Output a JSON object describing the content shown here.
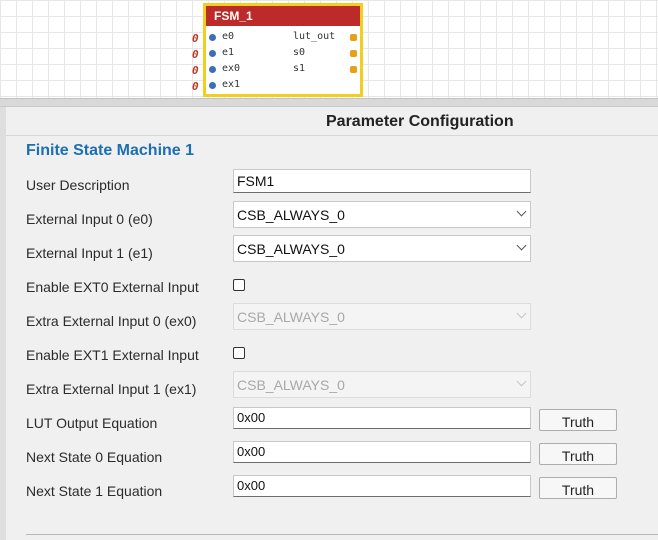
{
  "block": {
    "title": "FSM_1",
    "inputs": [
      "e0",
      "e1",
      "ex0",
      "ex1"
    ],
    "outputs": [
      "lut_out",
      "s0",
      "s1"
    ],
    "input_values": [
      "0",
      "0",
      "0",
      "0"
    ]
  },
  "panel": {
    "header": "Parameter Configuration",
    "section_title": "Finite State Machine 1",
    "fields": {
      "user_description": {
        "label": "User Description",
        "value": "FSM1"
      },
      "external_input_0": {
        "label": "External Input 0 (e0)",
        "value": "CSB_ALWAYS_0"
      },
      "external_input_1": {
        "label": "External Input 1 (e1)",
        "value": "CSB_ALWAYS_0"
      },
      "enable_ext0": {
        "label": "Enable EXT0 External Input",
        "checked": false
      },
      "extra_input_0": {
        "label": "Extra External Input 0 (ex0)",
        "value": "CSB_ALWAYS_0"
      },
      "enable_ext1": {
        "label": "Enable EXT1 External Input",
        "checked": false
      },
      "extra_input_1": {
        "label": "Extra External Input 1 (ex1)",
        "value": "CSB_ALWAYS_0"
      },
      "lut_output_equation": {
        "label": "LUT Output Equation",
        "value": "0x00",
        "button": "Truth"
      },
      "next_state_0_equation": {
        "label": "Next State 0 Equation",
        "value": "0x00",
        "button": "Truth"
      },
      "next_state_1_equation": {
        "label": "Next State 1 Equation",
        "value": "0x00",
        "button": "Truth"
      }
    }
  },
  "colors": {
    "block_title_bg": "#bc2a2a",
    "block_border": "#f2cf1f",
    "section_title": "#1c6fb5",
    "input_pin": "#3b6fb0",
    "output_pin": "#e3a21a",
    "constant_zero": "#c0392b"
  }
}
